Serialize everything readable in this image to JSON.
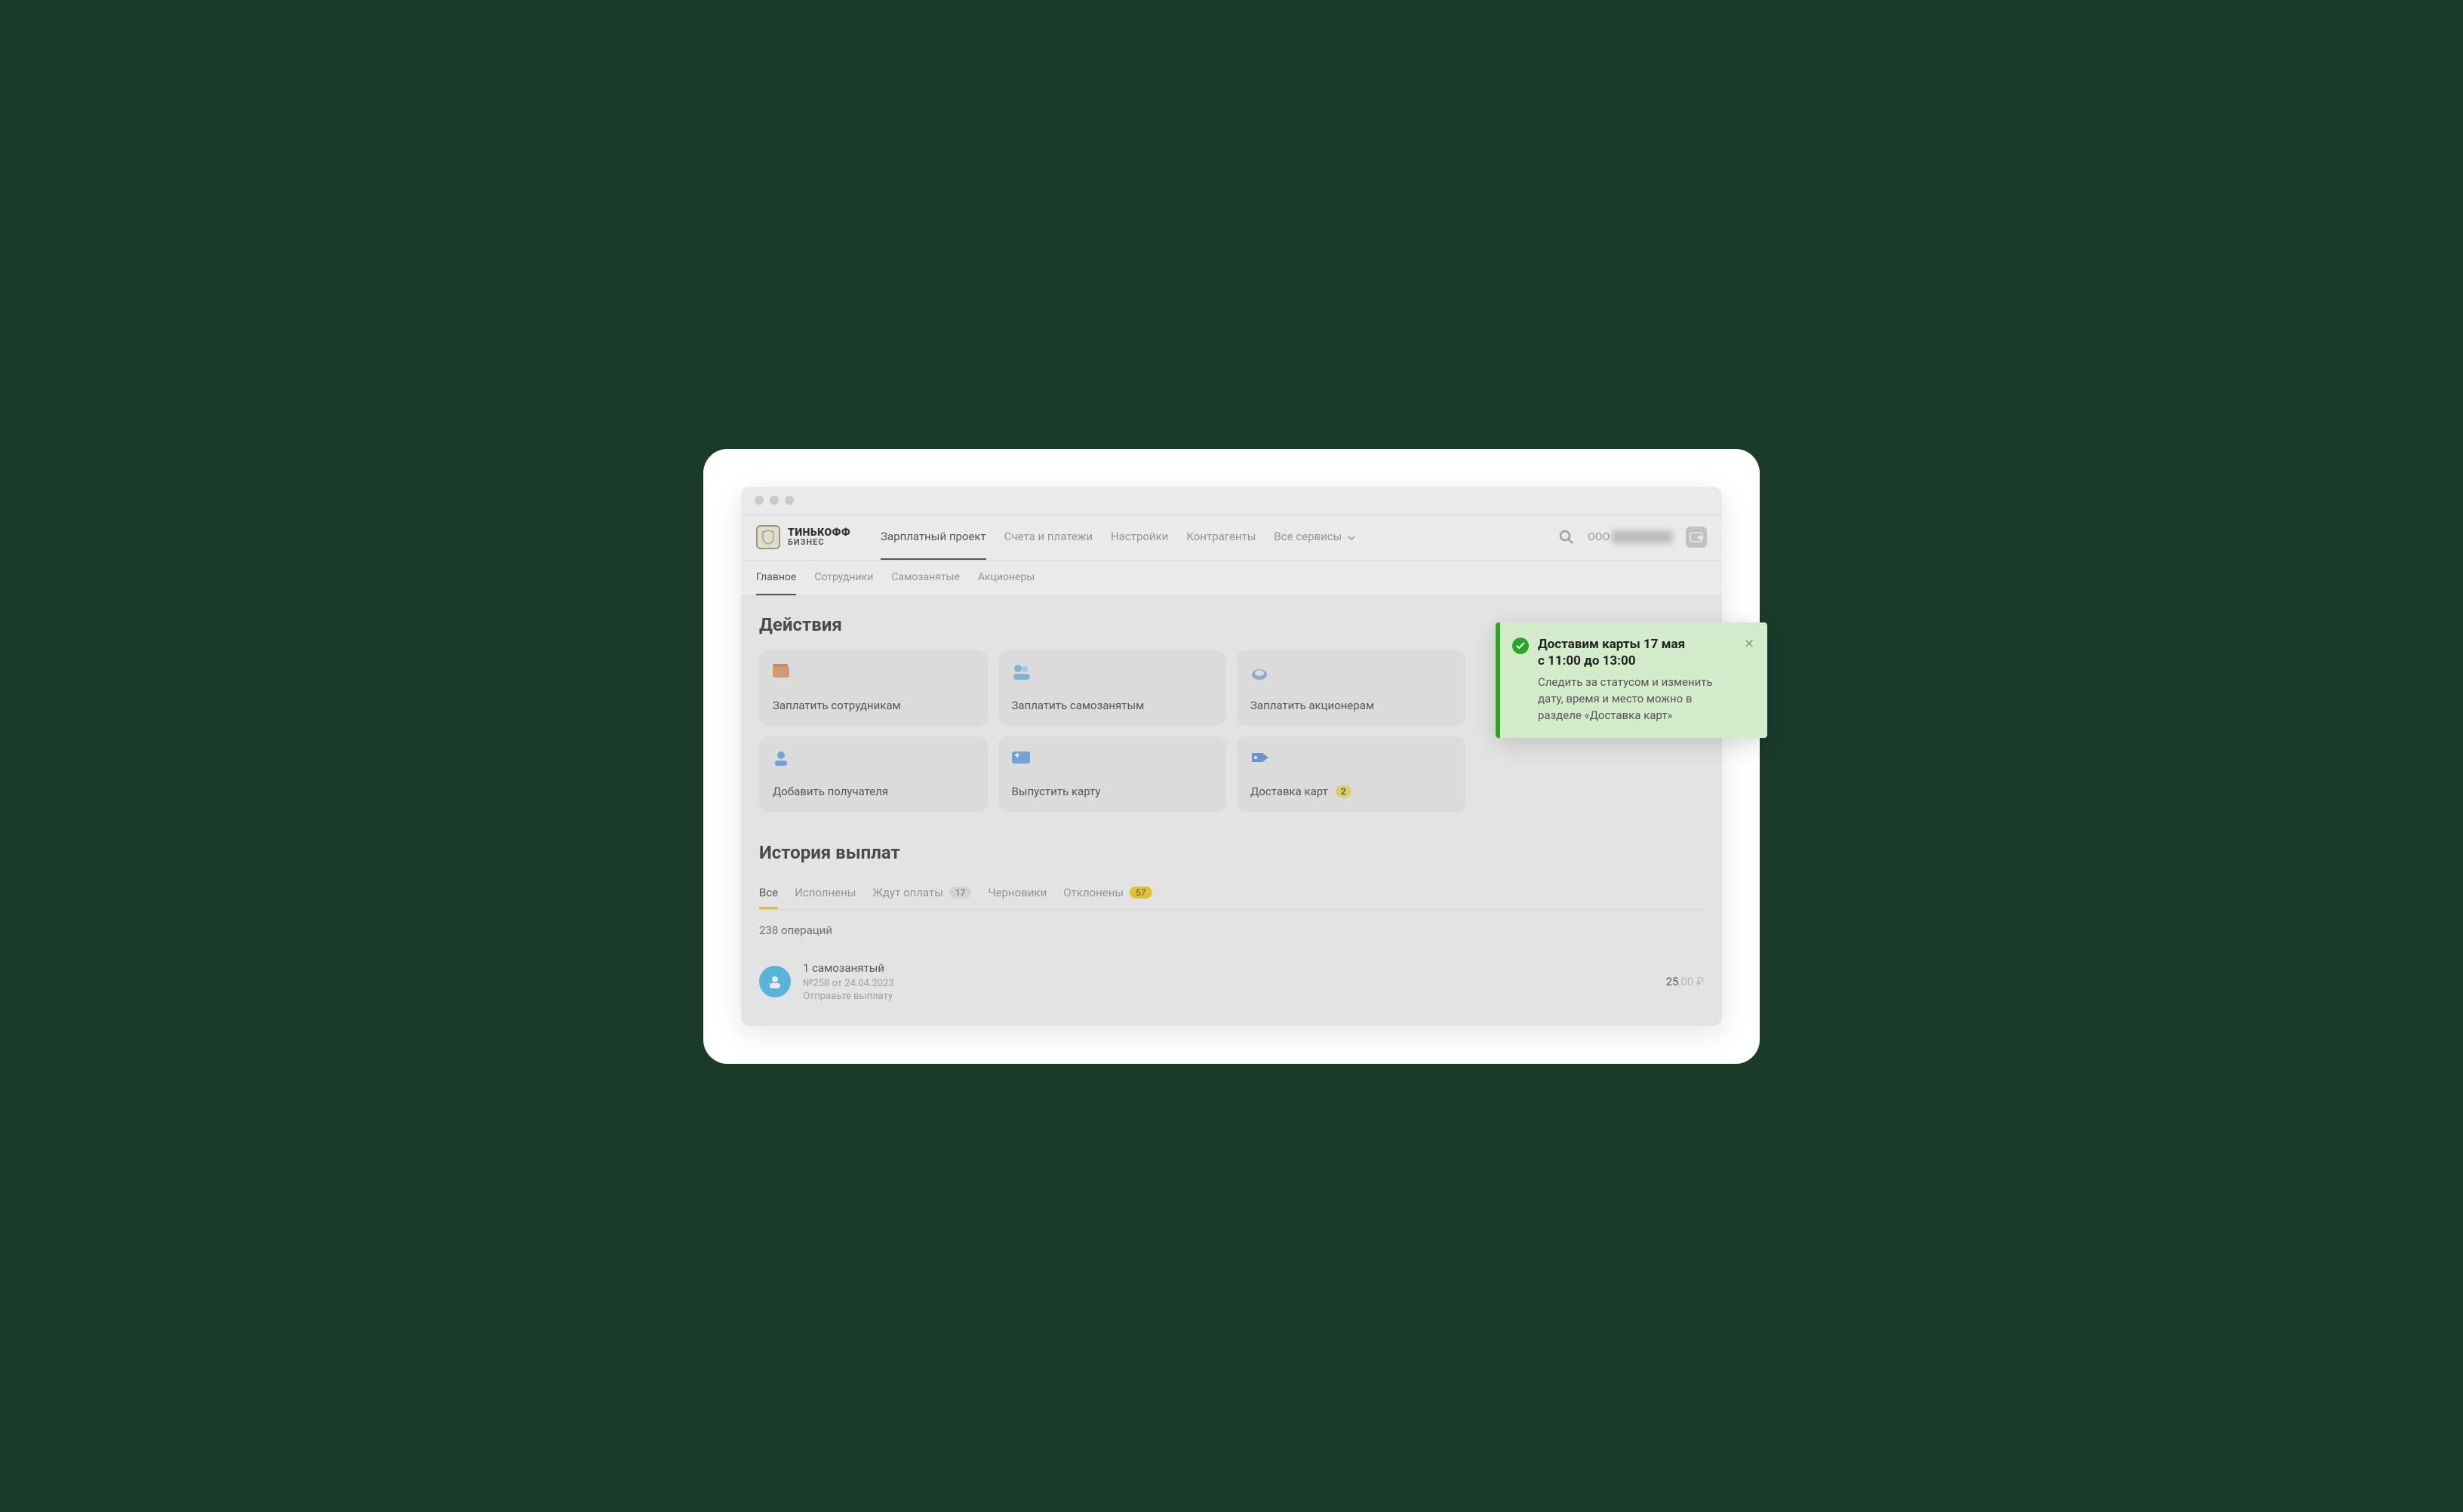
{
  "brand": {
    "line1": "ТИНЬКОФФ",
    "line2": "БИЗНЕС"
  },
  "nav": {
    "items": [
      {
        "label": "Зарплатный проект",
        "active": true
      },
      {
        "label": "Счета и платежи"
      },
      {
        "label": "Настройки"
      },
      {
        "label": "Контрагенты"
      },
      {
        "label": "Все сервисы",
        "dropdown": true
      }
    ]
  },
  "company_prefix": "ООО",
  "subnav": {
    "items": [
      {
        "label": "Главное",
        "active": true
      },
      {
        "label": "Сотрудники"
      },
      {
        "label": "Самозанятые"
      },
      {
        "label": "Акционеры"
      }
    ]
  },
  "actions": {
    "title": "Действия",
    "cards": [
      {
        "label": "Заплатить сотрудникам",
        "icon": "wallet"
      },
      {
        "label": "Заплатить самозанятым",
        "icon": "persons"
      },
      {
        "label": "Заплатить акционерам",
        "icon": "ring"
      },
      {
        "label": "",
        "icon": ""
      },
      {
        "label": "Добавить получателя",
        "icon": "person-add"
      },
      {
        "label": "Выпустить карту",
        "icon": "card-plus"
      },
      {
        "label": "Доставка карт",
        "icon": "tag",
        "badge": "2"
      },
      {
        "label": "",
        "icon": ""
      }
    ]
  },
  "history": {
    "title": "История выплат",
    "tabs": [
      {
        "label": "Все",
        "active": true
      },
      {
        "label": "Исполнены"
      },
      {
        "label": "Ждут оплаты",
        "badge": "17"
      },
      {
        "label": "Черновики"
      },
      {
        "label": "Отклонены",
        "badge": "57",
        "warn": true
      }
    ],
    "count_label": "238 операций",
    "rows": [
      {
        "title": "1 самозанятый",
        "meta": "№258 от 24.04.2023",
        "hint": "Отправьте выплату",
        "amount_int": "25",
        "amount_dec": ",00 ₽"
      }
    ]
  },
  "toast": {
    "title_l1": "Доставим карты 17 мая",
    "title_l2": "с 11:00 до 13:00",
    "text": "Следить за статусом и изменить дату, время и место можно в разделе «Доставка карт»"
  }
}
